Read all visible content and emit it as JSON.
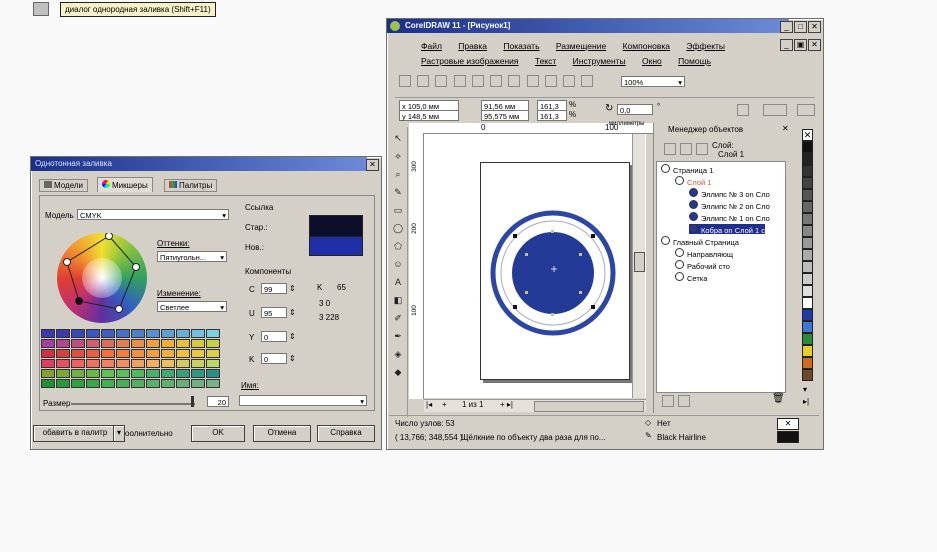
{
  "hint": {
    "text": "диалог однородная заливка (Shift+F11)"
  },
  "dialog": {
    "title": "Однотонная заливка",
    "tabs": [
      "Модели",
      "Микшеры",
      "Палитры"
    ],
    "model_label": "Модель",
    "model_value": "CMYK",
    "hues_label": "Оттенки:",
    "hues_value": "Пятиугольн...",
    "change_label": "Изменение:",
    "change_value": "Светлее",
    "size_label": "Размер",
    "size_value": "20",
    "reference_label": "Ссылка",
    "old_label": "Стар.:",
    "new_label": "Нов.:",
    "components_label": "Компоненты",
    "comp_c_label": "C",
    "comp_c_value": "99",
    "comp_m_label": "U",
    "comp_m_value": "95",
    "comp_y_label": "Y",
    "comp_y_value": "0",
    "comp_k_label": "K",
    "comp_k_value": "0",
    "right_k_label": "K",
    "right_k_value": "65",
    "right_v2": "3 0",
    "right_v3": "3 228",
    "name_label": "Имя:",
    "add_palette": "обавить в палитр",
    "options": "оолнительно",
    "ok": "OK",
    "cancel": "Отмена",
    "help": "Справка"
  },
  "app": {
    "title": "CorelDRAW 11 - [Рисунок1]",
    "menu1": [
      "Файл",
      "Правка",
      "Показать",
      "Размещение",
      "Компоновка",
      "Эффекты"
    ],
    "menu2": [
      "Растровые изображения",
      "Текст",
      "Инструменты",
      "Окно",
      "Помощь"
    ],
    "zoom": "100%",
    "pos_x": "x 105,0 мм",
    "pos_y": "y 148,5 мм",
    "size_w": "91,56 мм",
    "size_h": "95,575 мм",
    "scale_x": "161,3",
    "scale_y": "161,3",
    "pct": "%",
    "angle": "0,0",
    "ruler_units": "миллиметры",
    "ruler_top_ticks": [
      "0",
      "100"
    ],
    "ruler_left_ticks": [
      "300",
      "200",
      "100"
    ],
    "page_nav": "1 из 1",
    "status_nodes": "Число узлов: 53",
    "status_coords": "( 13,766; 348,554 )",
    "status_hint": "Щёлкние по объекту два раза для по...",
    "fill_none": "Нет",
    "outline": "Black  Hairline"
  },
  "objmgr": {
    "title": "Менеджер объектов",
    "layer_label": "Слой:",
    "layer_value": "Слой 1",
    "items": [
      {
        "text": "Страница 1",
        "indent": 0
      },
      {
        "text": "Слой 1",
        "indent": 1,
        "color": "#e05030"
      },
      {
        "text": "Эллипс № 3 on Сло",
        "indent": 2
      },
      {
        "text": "Эллипс № 2 on Сло",
        "indent": 2
      },
      {
        "text": "Эллипс № 1 on Сло",
        "indent": 2
      },
      {
        "text": "Кобра on Слой 1 с",
        "indent": 2,
        "selected": true
      },
      {
        "text": "Главный Страница",
        "indent": 0
      },
      {
        "text": "Направляющ",
        "indent": 1
      },
      {
        "text": "Рабочий сто",
        "indent": 1
      },
      {
        "text": "Сетка",
        "indent": 1
      }
    ]
  },
  "colors": {
    "title_blue": "#1a2f8a",
    "ellipse_fill": "#233a96",
    "ellipse_ring": "#2c46a6"
  }
}
